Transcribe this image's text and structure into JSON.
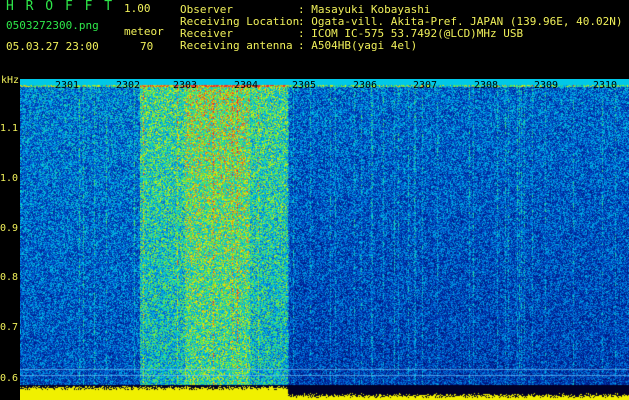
{
  "header": {
    "app_title": "H R O F F T",
    "version": "1.00",
    "file_name": "0503272300.png",
    "mode": "meteor",
    "date_time": "05.03.27 23:00",
    "count": "70"
  },
  "info": [
    {
      "label": "Observer",
      "value": ": Masayuki Kobayashi"
    },
    {
      "label": "Receiving Location",
      "value": ": Ogata-vill. Akita-Pref. JAPAN (139.96E, 40.02N)"
    },
    {
      "label": "Receiver",
      "value": ": ICOM IC-575 53.7492(@LCD)MHz USB"
    },
    {
      "label": "Receiving antenna",
      "value": ": A504HB(yagi 4el)"
    }
  ],
  "axes": {
    "y_unit": "kHz",
    "y_ticks": [
      "1.1",
      "1.0",
      "0.9",
      "0.8",
      "0.7",
      "0.6"
    ],
    "x_ticks": [
      "2301",
      "2302",
      "2303",
      "2304",
      "2305",
      "2306",
      "2307",
      "2308",
      "2309",
      "2310"
    ]
  },
  "colors": {
    "text_green": "#2ee84a",
    "text_yellow": "#f0f05a",
    "background": "#000000"
  }
}
